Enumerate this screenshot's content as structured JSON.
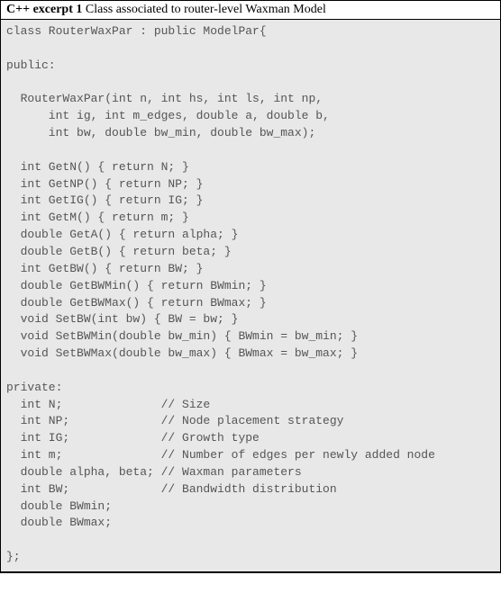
{
  "header": {
    "title": "C++ excerpt 1",
    "description": " Class associated to router-level Waxman Model"
  },
  "code": {
    "lines": [
      "class RouterWaxPar : public ModelPar{",
      "",
      "public:",
      "",
      "  RouterWaxPar(int n, int hs, int ls, int np,",
      "      int ig, int m_edges, double a, double b,",
      "      int bw, double bw_min, double bw_max);",
      "",
      "  int GetN() { return N; }",
      "  int GetNP() { return NP; }",
      "  int GetIG() { return IG; }",
      "  int GetM() { return m; }",
      "  double GetA() { return alpha; }",
      "  double GetB() { return beta; }",
      "  int GetBW() { return BW; }",
      "  double GetBWMin() { return BWmin; }",
      "  double GetBWMax() { return BWmax; }",
      "  void SetBW(int bw) { BW = bw; }",
      "  void SetBWMin(double bw_min) { BWmin = bw_min; }",
      "  void SetBWMax(double bw_max) { BWmax = bw_max; }",
      "",
      "private:",
      "  int N;              // Size",
      "  int NP;             // Node placement strategy",
      "  int IG;             // Growth type",
      "  int m;              // Number of edges per newly added node",
      "  double alpha, beta; // Waxman parameters",
      "  int BW;             // Bandwidth distribution",
      "  double BWmin;",
      "  double BWmax;",
      "",
      "};"
    ]
  }
}
